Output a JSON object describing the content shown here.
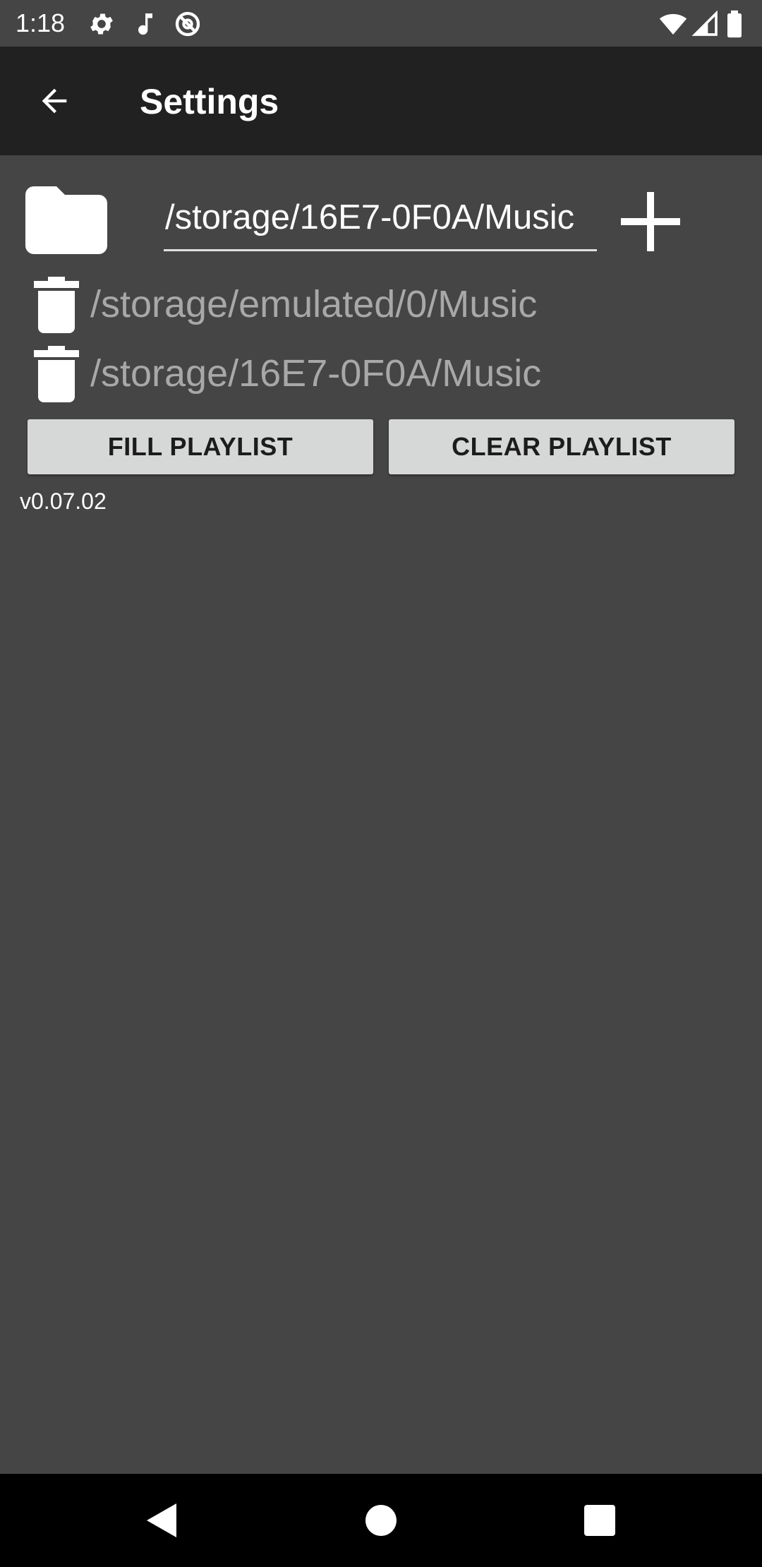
{
  "status_bar": {
    "time": "1:18",
    "icons_left": [
      "gear-icon",
      "music-note-icon",
      "no-signal-icon"
    ],
    "icons_right": [
      "wifi-icon",
      "cell-signal-icon",
      "battery-icon"
    ]
  },
  "app_bar": {
    "back_icon": "arrow-left-icon",
    "title": "Settings"
  },
  "folder_input": {
    "folder_icon": "folder-icon",
    "value": "/storage/16E7-0F0A/Music",
    "add_icon": "plus-icon"
  },
  "folders": [
    {
      "path": "/storage/emulated/0/Music",
      "icon": "trash-icon"
    },
    {
      "path": "/storage/16E7-0F0A/Music",
      "icon": "trash-icon"
    }
  ],
  "buttons": {
    "fill_playlist": "FILL PLAYLIST",
    "clear_playlist": "CLEAR PLAYLIST"
  },
  "version": "v0.07.02",
  "nav_bar": {
    "back": "triangle-back-icon",
    "home": "circle-home-icon",
    "recents": "square-recents-icon"
  },
  "colors": {
    "background": "#454545",
    "app_bar": "#212121",
    "button_bg": "#d6d7d7",
    "path_text": "#a8a8a8",
    "nav_bar": "#000000"
  }
}
